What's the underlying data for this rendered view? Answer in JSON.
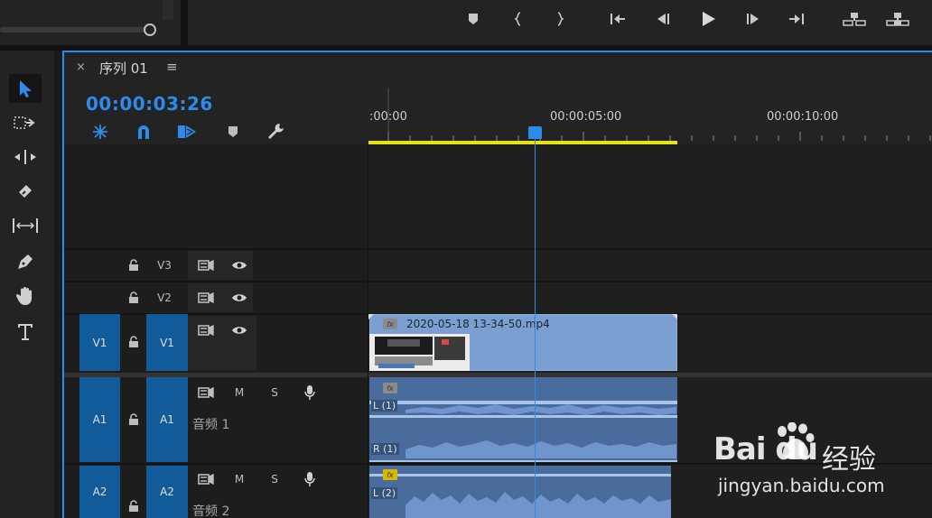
{
  "panel": {
    "close_glyph": "×",
    "title": "序列 01",
    "menu_glyph": "≡"
  },
  "timecode": "00:00:03:26",
  "ruler": {
    "labels": [
      ":00:00",
      "00:00:05:00",
      "00:00:10:00"
    ]
  },
  "tracks": {
    "v3": {
      "label": "V3"
    },
    "v2": {
      "label": "V2"
    },
    "v1": {
      "source_label": "V1",
      "label": "V1"
    },
    "a1": {
      "source_label": "A1",
      "label": "A1",
      "name": "音频 1",
      "mute": "M",
      "solo": "S"
    },
    "a2": {
      "source_label": "A2",
      "label": "A2",
      "name": "音频 2",
      "mute": "M",
      "solo": "S"
    }
  },
  "clips": {
    "video": {
      "name": "2020-05-18 13-34-50.mp4",
      "fx": "fx"
    },
    "audio1": {
      "fx": "fx",
      "left_channel": "L (1)",
      "right_channel": "R (1)"
    },
    "audio2": {
      "fx": "fx",
      "left_channel": "L (2)"
    }
  },
  "icons": {
    "transport": [
      "marker-icon",
      "mark-in-icon",
      "mark-out-icon",
      "go-to-in-icon",
      "step-back-icon",
      "play-icon",
      "step-forward-icon",
      "go-to-out-icon",
      "insert-icon",
      "overwrite-icon"
    ],
    "tools": [
      "selection-tool-icon",
      "track-select-tool-icon",
      "ripple-edit-tool-icon",
      "razor-tool-icon",
      "slip-tool-icon",
      "pen-tool-icon",
      "hand-tool-icon",
      "type-tool-icon"
    ]
  },
  "colors": {
    "accent": "#2d8ceb",
    "work_area": "#e8e314",
    "video_clip": "#7b9fd1",
    "audio_clip": "#4a6c9c",
    "track_patch": "#125b9a"
  },
  "watermark": {
    "logo": "Bai du",
    "cn": "经验",
    "url": "jingyan.baidu.com"
  }
}
